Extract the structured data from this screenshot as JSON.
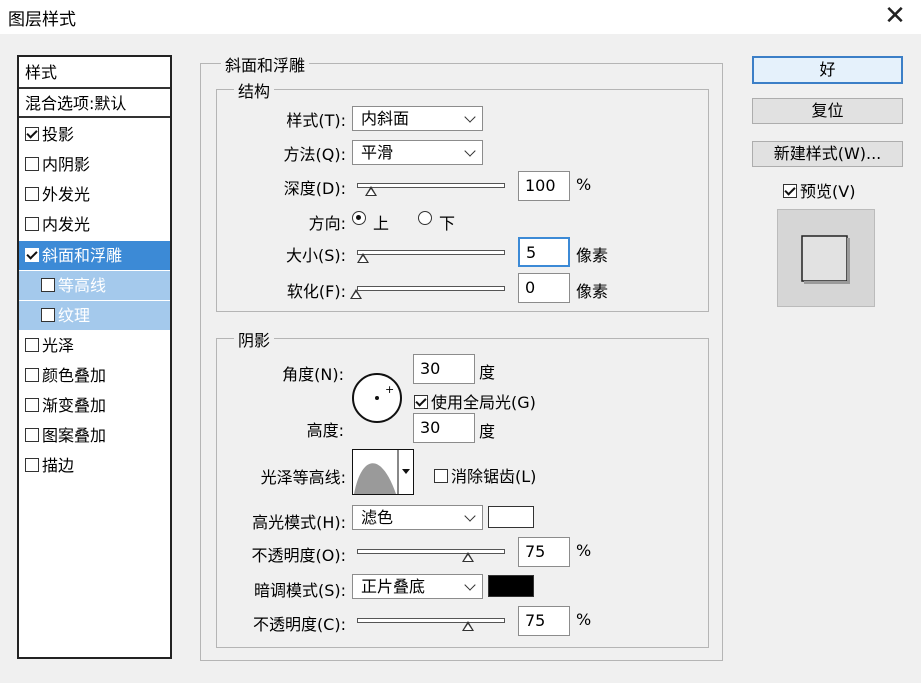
{
  "dialog": {
    "title": "图层样式"
  },
  "list": {
    "header": "样式",
    "blend": "混合选项:默认",
    "items": [
      {
        "label": "投影",
        "checked": true
      },
      {
        "label": "内阴影",
        "checked": false
      },
      {
        "label": "外发光",
        "checked": false
      },
      {
        "label": "内发光",
        "checked": false
      },
      {
        "label": "斜面和浮雕",
        "checked": true
      },
      {
        "label": "等高线",
        "checked": false
      },
      {
        "label": "纹理",
        "checked": false
      },
      {
        "label": "光泽",
        "checked": false
      },
      {
        "label": "颜色叠加",
        "checked": false
      },
      {
        "label": "渐变叠加",
        "checked": false
      },
      {
        "label": "图案叠加",
        "checked": false
      },
      {
        "label": "描边",
        "checked": false
      }
    ]
  },
  "bevel": {
    "title": "斜面和浮雕",
    "structure": {
      "title": "结构",
      "style_label": "样式(T):",
      "style_value": "内斜面",
      "technique_label": "方法(Q):",
      "technique_value": "平滑",
      "depth_label": "深度(D):",
      "depth_value": "100",
      "depth_unit": "%",
      "direction_label": "方向:",
      "dir_up": "上",
      "dir_down": "下",
      "size_label": "大小(S):",
      "size_value": "5",
      "size_unit": "像素",
      "soften_label": "软化(F):",
      "soften_value": "0",
      "soften_unit": "像素"
    },
    "shading": {
      "title": "阴影",
      "angle_label": "角度(N):",
      "angle_value": "30",
      "angle_unit": "度",
      "global_light_label": "使用全局光(G)",
      "altitude_label": "高度:",
      "altitude_value": "30",
      "altitude_unit": "度",
      "gloss_label": "光泽等高线:",
      "antialias_label": "消除锯齿(L)",
      "highlight_mode_label": "高光模式(H):",
      "highlight_mode_value": "滤色",
      "highlight_color": "#ffffff",
      "opacity1_label": "不透明度(O):",
      "opacity1_value": "75",
      "opacity1_unit": "%",
      "shadow_mode_label": "暗调模式(S):",
      "shadow_mode_value": "正片叠底",
      "shadow_color": "#000000",
      "opacity2_label": "不透明度(C):",
      "opacity2_value": "75",
      "opacity2_unit": "%"
    }
  },
  "buttons": {
    "ok": "好",
    "reset": "复位",
    "new_style": "新建样式(W)...",
    "preview": "预览(V)"
  }
}
